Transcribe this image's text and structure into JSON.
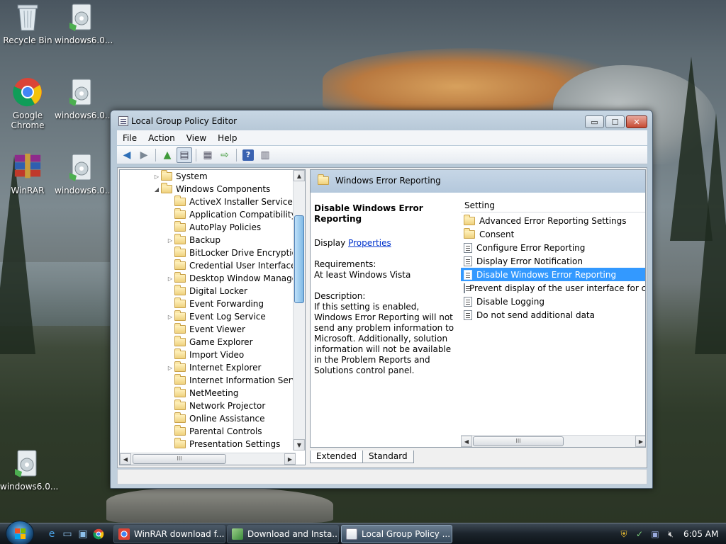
{
  "desktop": {
    "icons": [
      {
        "label": "Recycle Bin"
      },
      {
        "label": "windows6.0..."
      },
      {
        "label": "Google Chrome"
      },
      {
        "label": "windows6.0..."
      },
      {
        "label": "WinRAR"
      },
      {
        "label": "windows6.0..."
      },
      {
        "label": "windows6.0..."
      }
    ]
  },
  "window": {
    "title": "Local Group Policy Editor",
    "controls": {
      "minimize": "▭",
      "maximize": "☐",
      "close": "✕"
    },
    "menu": [
      "File",
      "Action",
      "View",
      "Help"
    ],
    "toolbar": [
      {
        "icon": "back-arrow-icon",
        "glyph": "◀"
      },
      {
        "icon": "forward-arrow-icon",
        "glyph": "▶"
      },
      {
        "icon": "up-folder-icon",
        "glyph": "▲"
      },
      {
        "icon": "show-hide-tree-icon",
        "glyph": "▤"
      },
      {
        "icon": "properties-icon",
        "glyph": "▦"
      },
      {
        "icon": "export-list-icon",
        "glyph": "⇨"
      },
      {
        "icon": "help-icon",
        "glyph": "?"
      },
      {
        "icon": "filter-icon",
        "glyph": "▥"
      }
    ]
  },
  "tree": {
    "items": [
      {
        "label": "System",
        "level": 1,
        "expander": "▷"
      },
      {
        "label": "Windows Components",
        "level": 1,
        "expander": "◢"
      },
      {
        "label": "ActiveX Installer Service",
        "level": 2,
        "expander": ""
      },
      {
        "label": "Application Compatibility",
        "level": 2,
        "expander": ""
      },
      {
        "label": "AutoPlay Policies",
        "level": 2,
        "expander": ""
      },
      {
        "label": "Backup",
        "level": 2,
        "expander": "▷"
      },
      {
        "label": "BitLocker Drive Encryption",
        "level": 2,
        "expander": ""
      },
      {
        "label": "Credential User Interface",
        "level": 2,
        "expander": ""
      },
      {
        "label": "Desktop Window Manager",
        "level": 2,
        "expander": "▷"
      },
      {
        "label": "Digital Locker",
        "level": 2,
        "expander": ""
      },
      {
        "label": "Event Forwarding",
        "level": 2,
        "expander": ""
      },
      {
        "label": "Event Log Service",
        "level": 2,
        "expander": "▷"
      },
      {
        "label": "Event Viewer",
        "level": 2,
        "expander": ""
      },
      {
        "label": "Game Explorer",
        "level": 2,
        "expander": ""
      },
      {
        "label": "Import Video",
        "level": 2,
        "expander": ""
      },
      {
        "label": "Internet Explorer",
        "level": 2,
        "expander": "▷"
      },
      {
        "label": "Internet Information Service",
        "level": 2,
        "expander": ""
      },
      {
        "label": "NetMeeting",
        "level": 2,
        "expander": ""
      },
      {
        "label": "Network Projector",
        "level": 2,
        "expander": ""
      },
      {
        "label": "Online Assistance",
        "level": 2,
        "expander": ""
      },
      {
        "label": "Parental Controls",
        "level": 2,
        "expander": ""
      },
      {
        "label": "Presentation Settings",
        "level": 2,
        "expander": ""
      }
    ],
    "hscroll_thumb": "III"
  },
  "detail": {
    "header": "Windows Error Reporting",
    "setting_title": "Disable Windows Error Reporting",
    "display_label": "Display",
    "properties_link": "Properties",
    "requirements_label": "Requirements:",
    "requirements_value": "At least Windows Vista",
    "description_label": "Description:",
    "description_text": "If this setting is enabled, Windows Error Reporting will not send any problem information to Microsoft. Additionally, solution information will not be available in the Problem Reports and Solutions control panel.",
    "column_header": "Setting",
    "items": [
      {
        "label": "Advanced Error Reporting Settings",
        "type": "folder",
        "selected": false
      },
      {
        "label": "Consent",
        "type": "folder",
        "selected": false
      },
      {
        "label": "Configure Error Reporting",
        "type": "policy",
        "selected": false
      },
      {
        "label": "Display Error Notification",
        "type": "policy",
        "selected": false
      },
      {
        "label": "Disable Windows Error Reporting",
        "type": "policy",
        "selected": true
      },
      {
        "label": "Prevent display of the user interface for critica",
        "type": "policy",
        "selected": false
      },
      {
        "label": "Disable Logging",
        "type": "policy",
        "selected": false
      },
      {
        "label": "Do not send additional data",
        "type": "policy",
        "selected": false
      }
    ],
    "hscroll_thumb": "III",
    "tabs": [
      "Extended",
      "Standard"
    ],
    "active_tab": "Extended"
  },
  "taskbar": {
    "tasks": [
      {
        "label": "WinRAR download f...",
        "icon": "chrome-icon",
        "active": false
      },
      {
        "label": "Download and Insta...",
        "icon": "setup-icon",
        "active": false
      },
      {
        "label": "Local Group Policy ...",
        "icon": "gpedit-icon",
        "active": true
      }
    ],
    "clock": "6:05 AM"
  },
  "colors": {
    "selection": "#3399ff",
    "link": "#0033cc",
    "title_band": "#b4c8dc"
  }
}
